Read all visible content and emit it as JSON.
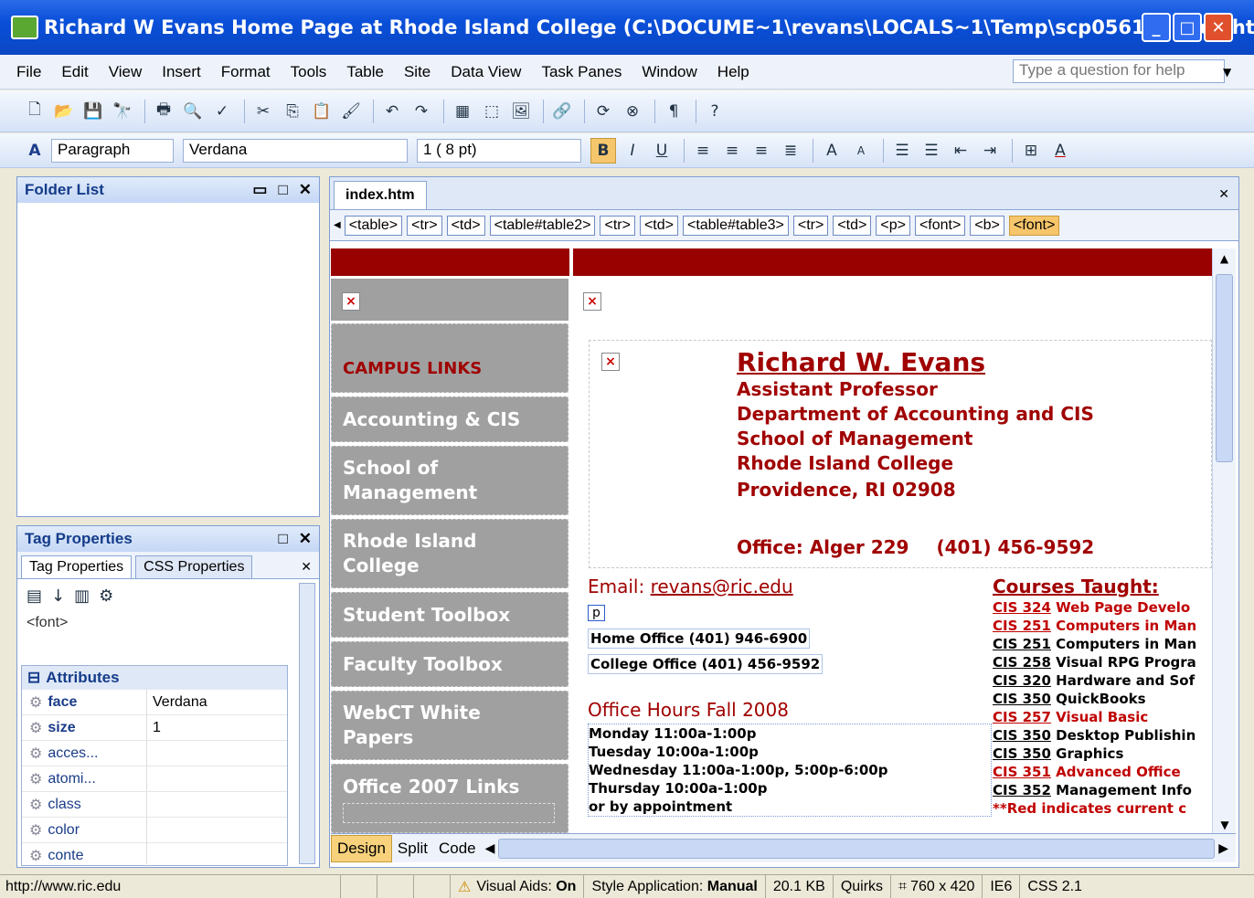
{
  "window": {
    "title": "Richard W Evans Home Page at Rhode Island College (C:\\DOCUME~1\\revans\\LOCALS~1\\Temp\\scp05613\\index.ht..."
  },
  "menu": [
    "File",
    "Edit",
    "View",
    "Insert",
    "Format",
    "Tools",
    "Table",
    "Site",
    "Data View",
    "Task Panes",
    "Window",
    "Help"
  ],
  "help_placeholder": "Type a question for help",
  "format_toolbar": {
    "style": "Paragraph",
    "font": "Verdana",
    "size": "1 ( 8 pt)"
  },
  "folder_list": {
    "title": "Folder List"
  },
  "tag_properties": {
    "title": "Tag Properties",
    "tabs": [
      "Tag Properties",
      "CSS Properties"
    ],
    "current_tag": "<font>",
    "section": "Attributes",
    "attrs": [
      {
        "name": "face",
        "value": "Verdana"
      },
      {
        "name": "size",
        "value": "1"
      },
      {
        "name": "acces...",
        "value": ""
      },
      {
        "name": "atomi...",
        "value": ""
      },
      {
        "name": "class",
        "value": ""
      },
      {
        "name": "color",
        "value": ""
      },
      {
        "name": "conte",
        "value": ""
      }
    ]
  },
  "doc_tab": "index.htm",
  "breadcrumbs": [
    "<table>",
    "<tr>",
    "<td>",
    "<table#table2>",
    "<tr>",
    "<td>",
    "<table#table3>",
    "<tr>",
    "<td>",
    "<p>",
    "<font>",
    "<b>",
    "<font>"
  ],
  "nav": {
    "heading": "CAMPUS LINKS",
    "items": [
      "Accounting & CIS",
      "School of Management",
      "Rhode Island College",
      "Student Toolbox",
      "Faculty Toolbox",
      "WebCT White Papers",
      "Office 2007 Links"
    ]
  },
  "profile": {
    "name": "Richard W. Evans",
    "lines": [
      "Assistant Professor",
      "Department of Accounting and CIS",
      "School of Management",
      "Rhode Island College",
      "Providence, RI 02908"
    ],
    "office": "Office: Alger 229",
    "phone": "(401) 456-9592"
  },
  "contact": {
    "email_label": "Email:",
    "email": "revans@ric.edu",
    "p_tag": "p",
    "home": "Home Office (401) 946-6900",
    "college": "College Office (401) 456-9592"
  },
  "hours": {
    "title": "Office Hours Fall 2008",
    "lines": [
      "Monday 11:00a-1:00p",
      "Tuesday 10:00a-1:00p",
      "Wednesday 11:00a-1:00p, 5:00p-6:00p",
      "Thursday  10:00a-1:00p",
      "or by appointment"
    ]
  },
  "courses": {
    "title": "Courses Taught:",
    "items": [
      {
        "code": "CIS 324",
        "name": " Web Page Develo",
        "current": true
      },
      {
        "code": "CIS 251",
        "name": " Computers in Man",
        "current": true
      },
      {
        "code": "CIS 251",
        "name": " Computers in Man",
        "current": false
      },
      {
        "code": "CIS 258",
        "name": " Visual RPG Progra",
        "current": false
      },
      {
        "code": "CIS 320",
        "name": " Hardware and Sof",
        "current": false
      },
      {
        "code": "CIS 350",
        "name": " QuickBooks",
        "current": false
      },
      {
        "code": "CIS 257",
        "name": " Visual Basic",
        "current": true
      },
      {
        "code": "CIS 350",
        "name": " Desktop Publishin",
        "current": false
      },
      {
        "code": "CIS 350",
        "name": " Graphics",
        "current": false
      },
      {
        "code": "CIS 351",
        "name": " Advanced Office",
        "current": true
      },
      {
        "code": "CIS 352",
        "name": " Management Info",
        "current": false
      }
    ],
    "note": "**Red indicates current c"
  },
  "view_tabs": [
    "Design",
    "Split",
    "Code"
  ],
  "status": {
    "url": "http://www.ric.edu",
    "visual_aids_label": "Visual Aids:",
    "visual_aids": "On",
    "style_label": "Style Application:",
    "style": "Manual",
    "size": "20.1 KB",
    "mode": "Quirks",
    "dims": "760 x 420",
    "browser": "IE6",
    "css": "CSS 2.1"
  },
  "colors": {
    "accent": "#a00000",
    "titlebar": "#0a4fd8",
    "nav_bg": "#a0a0a0",
    "top_band": "#990000"
  }
}
